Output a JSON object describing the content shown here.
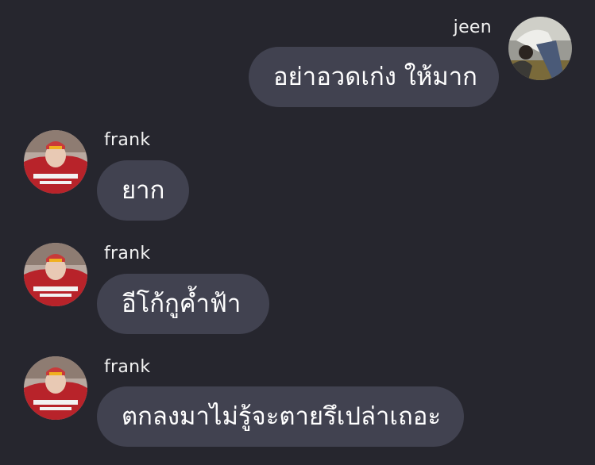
{
  "theme": {
    "background": "#26262e",
    "bubble": "#414250",
    "text": "#ffffff",
    "name_text": "#f2f2f2"
  },
  "messages": [
    {
      "sender": "jeen",
      "text": "อย่าอวดเก่ง ให้มาก",
      "side": "right",
      "avatar": "avatar-jeen"
    },
    {
      "sender": "frank",
      "text": "ยาก",
      "side": "left",
      "avatar": "avatar-frank"
    },
    {
      "sender": "frank",
      "text": "อีโก้กูค้ำฟ้า",
      "side": "left",
      "avatar": "avatar-frank"
    },
    {
      "sender": "frank",
      "text": "ตกลงมาไม่รู้จะตายรึเปล่าเถอะ",
      "side": "left",
      "avatar": "avatar-frank"
    }
  ]
}
